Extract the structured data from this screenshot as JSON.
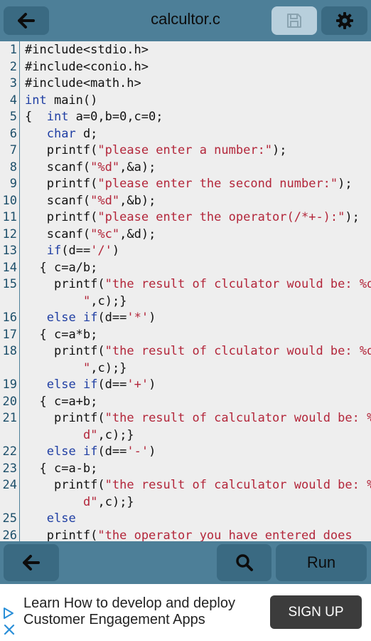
{
  "header": {
    "title": "calcultor.c"
  },
  "editor": {
    "lines": [
      {
        "n": "1",
        "code": "#include<stdio.h>",
        "indent": 0
      },
      {
        "n": "2",
        "code": "#include<conio.h>",
        "indent": 0
      },
      {
        "n": "3",
        "code": "#include<math.h>",
        "indent": 0
      },
      {
        "n": "4",
        "code": "int main()",
        "indent": 0
      },
      {
        "n": "5",
        "code": "{  int a=0,b=0,c=0;",
        "indent": 0
      },
      {
        "n": "6",
        "code": "char d;",
        "indent": 3
      },
      {
        "n": "7",
        "code": "printf(\"please enter a number:\");",
        "indent": 3
      },
      {
        "n": "8",
        "code": "scanf(\"%d\",&a);",
        "indent": 3
      },
      {
        "n": "9",
        "code": "printf(\"please enter the second number:\");",
        "indent": 3
      },
      {
        "n": "10",
        "code": "scanf(\"%d\",&b);",
        "indent": 3
      },
      {
        "n": "11",
        "code": "printf(\"please enter the operator(/*+-):\");",
        "indent": 3
      },
      {
        "n": "12",
        "code": "scanf(\"%c\",&d);",
        "indent": 3
      },
      {
        "n": "13",
        "code": "if(d=='/')",
        "indent": 3
      },
      {
        "n": "14",
        "code": "{ c=a/b;",
        "indent": 2
      },
      {
        "n": "15",
        "code": "printf(\"the result of clculator would be: %d",
        "indent": 4,
        "cont": "\",c);}",
        "contIndent": 8
      },
      {
        "n": "16",
        "code": "else if(d=='*')",
        "indent": 3
      },
      {
        "n": "17",
        "code": "{ c=a*b;",
        "indent": 2
      },
      {
        "n": "18",
        "code": "printf(\"the result of clculator would be: %d",
        "indent": 4,
        "cont": "\",c);}",
        "contIndent": 8
      },
      {
        "n": "19",
        "code": "else if(d=='+')",
        "indent": 3
      },
      {
        "n": "20",
        "code": "{ c=a+b;",
        "indent": 2
      },
      {
        "n": "21",
        "code": "printf(\"the result of calculator would be: %",
        "indent": 4,
        "cont": "d\",c);}",
        "contIndent": 8
      },
      {
        "n": "22",
        "code": "else if(d=='-')",
        "indent": 3
      },
      {
        "n": "23",
        "code": "{ c=a-b;",
        "indent": 2
      },
      {
        "n": "24",
        "code": "printf(\"the result of calculator would be: %",
        "indent": 4,
        "cont": "d\",c);}",
        "contIndent": 8
      },
      {
        "n": "25",
        "code": "else",
        "indent": 3
      },
      {
        "n": "26",
        "code": "printf(\"the operator you have entered does",
        "indent": 3
      }
    ]
  },
  "toolbar": {
    "run_label": "Run"
  },
  "ad": {
    "text": "Learn How to develop and deploy Customer Engagement Apps",
    "button_label": "SIGN UP"
  },
  "icons": {
    "back": "arrow-left-icon",
    "save": "floppy-disk-icon",
    "settings": "gear-icon",
    "search": "search-icon",
    "ad_play": "ad-choices-icon",
    "ad_close": "close-icon"
  },
  "colors": {
    "bar": "#4d7f98",
    "button": "#3a6a82",
    "save_disabled": "#b8cfdc",
    "editor_bg": "#eeeeee",
    "keyword": "#1f3ea3",
    "string": "#b3263a"
  }
}
